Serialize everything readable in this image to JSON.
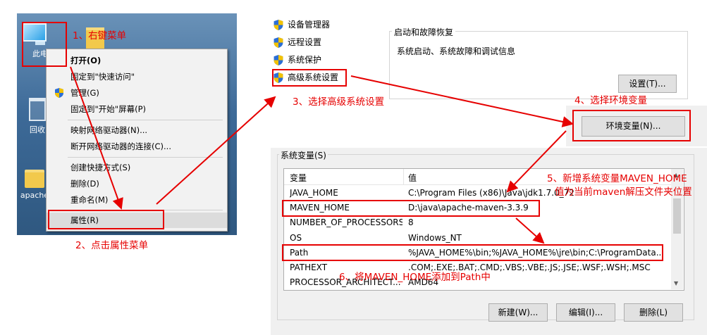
{
  "desktop": {
    "icons": [
      {
        "label": "此电",
        "icon": "computer-icon"
      },
      {
        "label": "回收",
        "icon": "recycle-bin-icon"
      },
      {
        "label": "apache",
        "icon": "folder-icon"
      }
    ],
    "menu": [
      {
        "label": "打开(O)",
        "bold": true
      },
      {
        "label": "固定到\"快速访问\""
      },
      {
        "label": "管理(G)",
        "icon": "uac-shield-icon"
      },
      {
        "label": "固定到\"开始\"屏幕(P)"
      },
      {
        "label": "映射网络驱动器(N)..."
      },
      {
        "label": "断开网络驱动器的连接(C)..."
      },
      {
        "label": "创建快捷方式(S)"
      },
      {
        "label": "删除(D)"
      },
      {
        "label": "重命名(M)"
      },
      {
        "label": "属性(R)"
      }
    ]
  },
  "system": {
    "links": [
      "设备管理器",
      "远程设置",
      "系统保护",
      "高级系统设置"
    ],
    "startup_group_title": "启动和故障恢复",
    "startup_desc": "系统启动、系统故障和调试信息",
    "settings_button": "设置(T)...",
    "env_button": "环境变量(N)..."
  },
  "env": {
    "group_title": "系统变量(S)",
    "headers": {
      "name": "变量",
      "value": "值"
    },
    "rows": [
      {
        "name": "JAVA_HOME",
        "value": "C:\\Program Files (x86)\\Java\\jdk1.7.0_72"
      },
      {
        "name": "MAVEN_HOME",
        "value": "D:\\java\\apache-maven-3.3.9"
      },
      {
        "name": "NUMBER_OF_PROCESSORS",
        "value": "8"
      },
      {
        "name": "OS",
        "value": "Windows_NT"
      },
      {
        "name": "Path",
        "value": "%JAVA_HOME%\\bin;%JAVA_HOME%\\jre\\bin;C:\\ProgramData..."
      },
      {
        "name": "PATHEXT",
        "value": ".COM;.EXE;.BAT;.CMD;.VBS;.VBE;.JS;.JSE;.WSF;.WSH;.MSC"
      },
      {
        "name": "PROCESSOR_ARCHITECT...",
        "value": "AMD64"
      }
    ],
    "buttons": {
      "new": "新建(W)...",
      "edit": "编辑(I)...",
      "delete": "删除(L)"
    }
  },
  "annotations": {
    "step1": "1、右键菜单",
    "step2": "2、点击属性菜单",
    "step3": "3、选择高级系统设置",
    "step4": "4、选择环境变量",
    "step5_line1": "5、新增系统变量MAVEN_HOME",
    "step5_line2": "值为当前maven解压文件夹位置",
    "step6": "6、将MAVEN_HOME添加到Path中"
  },
  "colors": {
    "annotation": "#e60000",
    "desktop": "#3d6a98",
    "menu_bg": "#f2f2f2"
  }
}
